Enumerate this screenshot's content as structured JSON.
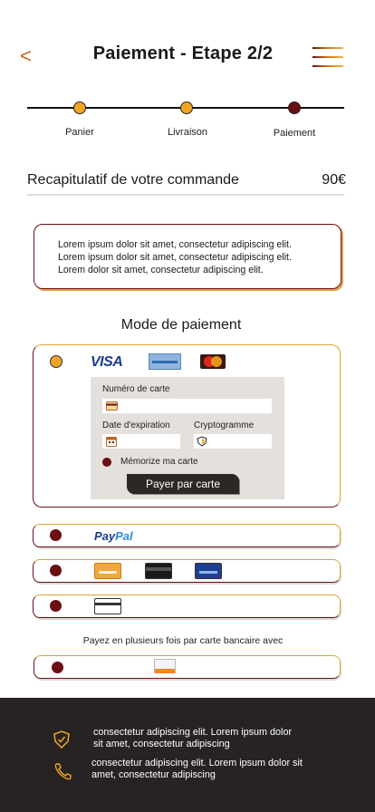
{
  "header": {
    "back_label": "<",
    "title": "Paiement - Etape 2/2"
  },
  "stepper": {
    "steps": [
      {
        "label": "Panier",
        "status": "done"
      },
      {
        "label": "Livraison",
        "status": "done"
      },
      {
        "label": "Paiement",
        "status": "current"
      }
    ]
  },
  "summary": {
    "title": "Recapitulatif de votre commande",
    "price": "90€"
  },
  "info_box": {
    "lines": [
      "Lorem ipsum dolor sit amet, consectetur adipiscing elit.",
      "Lorem ipsum dolor sit amet, consectetur adipiscing elit.",
      "Lorem dolor sit amet, consectetur adipiscing elit."
    ]
  },
  "payment": {
    "title": "Mode de paiement",
    "card": {
      "visa_label": "VISA",
      "card_number_label": "Numéro de carte",
      "expiry_label": "Date d'expiration",
      "cvv_label": "Cryptogramme",
      "remember_label": "Mémorize ma carte",
      "pay_button": "Payer par carte"
    },
    "paypal_part1": "Pay",
    "paypal_part2": "Pal",
    "installment_text": "Payez en plusieurs fois par carte bancaire avec"
  },
  "footer": {
    "items": [
      {
        "icon": "shield-check-icon",
        "line1": "consectetur adipiscing elit. Lorem ipsum dolor",
        "line2": "sit amet, consectetur adipiscing"
      },
      {
        "icon": "phone-icon",
        "line1": "consectetur adipiscing elit. Lorem ipsum dolor sit",
        "line2": "amet, consectetur adipiscing"
      }
    ]
  },
  "colors": {
    "accent_orange": "#f0a424",
    "accent_maroon": "#6b0f12",
    "footer_bg": "#262322"
  }
}
